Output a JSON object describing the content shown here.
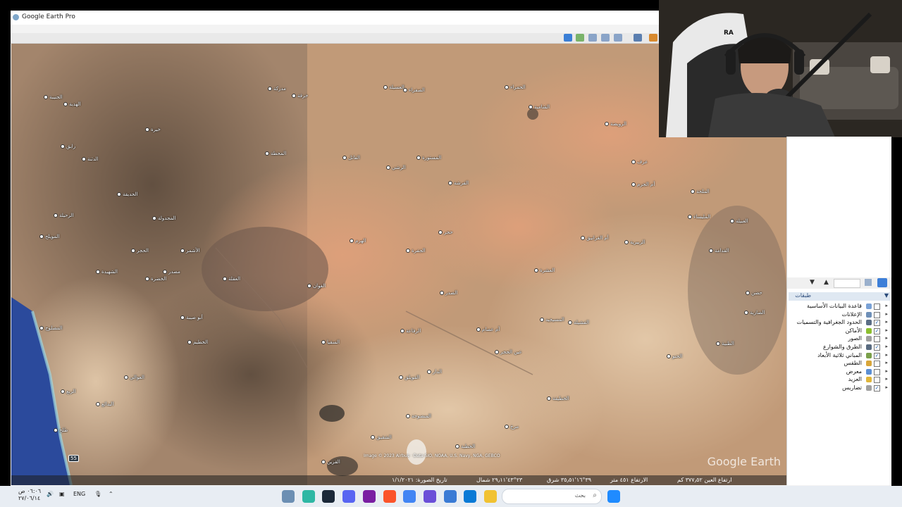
{
  "window": {
    "title": "Google Earth Pro"
  },
  "map": {
    "watermark": "Google Earth",
    "attribution": "Image © 2023 Airbus · Data SIO, NOAA, U.S. Navy, NGA, GEBCO",
    "road_marker": "55",
    "place_labels": [
      "الجنيبة",
      "الهدية",
      "رايق",
      "خيرة",
      "مدركة",
      "خرفة",
      "العسيلة",
      "الصفراء",
      "الحمراء",
      "الشامية",
      "الرويضة",
      "عرف",
      "المحطة",
      "الفاتل",
      "الرشي",
      "المستورة",
      "الفرشة",
      "أم الجرم",
      "الملحة",
      "حجر",
      "العشرة",
      "أم الغرانيق",
      "الزبيرية",
      "المليساء",
      "العبيلة",
      "القدامة",
      "المسيجيد",
      "الفشيلة",
      "الصدر",
      "أم عصام",
      "الرفاعة",
      "عين الحجر",
      "الحنو",
      "الظبية",
      "الصارية",
      "حضن",
      "الخطيفة",
      "مرخ",
      "الفويلق",
      "السقيا",
      "الهرم",
      "الجفرة",
      "الغوان",
      "العقلة",
      "المجدولة",
      "الحديقة",
      "الدثنة",
      "الرحيلة",
      "المويلح",
      "الحجر",
      "الأشمر",
      "مصدر",
      "أبو صيبة",
      "الخضرة",
      "الشهيدة",
      "الخطيم",
      "العوالي",
      "البدائع",
      "الريع",
      "المصلوح",
      "طلح",
      "الدار",
      "المنضوحة",
      "الخطبة",
      "القرين",
      "الشقيق"
    ],
    "status": {
      "imagery_date": "تاريخ الصورة: ١/١/٢٠٢١",
      "lat": "٢٣°٤٣'٢٩٫١١ شمال",
      "lon": "٣٩°١٦'٣٥٫٥١ شرق",
      "elevation": "الارتفاع ٤٥١ متر",
      "eye_alt": "ارتفاع العين ٣٧٧٫٥٢ كم"
    }
  },
  "sidebar": {
    "layers_title": "طبقات",
    "layers": [
      {
        "label": "قاعدة البيانات الأساسية",
        "checked": false,
        "icon_color": "#7aa2d6",
        "icon": "globe-icon"
      },
      {
        "label": "الإعلانات",
        "checked": false,
        "icon_color": "#6e8fb8",
        "icon": "megaphone-icon"
      },
      {
        "label": "الحدود الجغرافية والتسميات",
        "checked": true,
        "icon_color": "#5a6d85",
        "icon": "border-flag-icon"
      },
      {
        "label": "الأماكن",
        "checked": true,
        "icon_color": "#8cbf2f",
        "icon": "places-icon"
      },
      {
        "label": "الصور",
        "checked": false,
        "icon_color": "#a0a0a0",
        "icon": "photo-icon"
      },
      {
        "label": "الطرق والشوارع",
        "checked": true,
        "icon_color": "#596b80",
        "icon": "road-icon"
      },
      {
        "label": "المباني ثلاثية الأبعاد",
        "checked": true,
        "icon_color": "#7aa04a",
        "icon": "building-icon"
      },
      {
        "label": "الطقس",
        "checked": false,
        "icon_color": "#d9a63a",
        "icon": "weather-icon"
      },
      {
        "label": "معرض",
        "checked": false,
        "icon_color": "#5b8fd4",
        "icon": "gallery-icon"
      },
      {
        "label": "العزيد",
        "checked": false,
        "icon_color": "#e0b63a",
        "icon": "folder-icon"
      },
      {
        "label": "تضاريس",
        "checked": true,
        "icon_color": "#a0a0a0",
        "icon": "terrain-icon"
      }
    ]
  },
  "taskbar": {
    "search_placeholder": "بحث",
    "time": "٠٦:٠٦ ص",
    "date": "٢٧/٠٦/١٤",
    "lang": "ENG",
    "apps": [
      {
        "name": "google-earth-icon",
        "color": "#6c8fb3"
      },
      {
        "name": "app-s-icon",
        "color": "#2fb7a4"
      },
      {
        "name": "steam-icon",
        "color": "#1b2838"
      },
      {
        "name": "discord-icon",
        "color": "#5865f2"
      },
      {
        "name": "next-icon",
        "color": "#7a1fa2"
      },
      {
        "name": "brave-icon",
        "color": "#fb542b"
      },
      {
        "name": "chrome-icon",
        "color": "#4285f4"
      },
      {
        "name": "gem-icon",
        "color": "#6b4fd8"
      },
      {
        "name": "photos-icon",
        "color": "#3a7bd5"
      },
      {
        "name": "store-icon",
        "color": "#0a7ad6"
      },
      {
        "name": "explorer-icon",
        "color": "#f1c232"
      },
      {
        "name": "app-last-icon",
        "color": "#c94c4c"
      }
    ]
  },
  "webcam": {
    "label": "RA"
  }
}
